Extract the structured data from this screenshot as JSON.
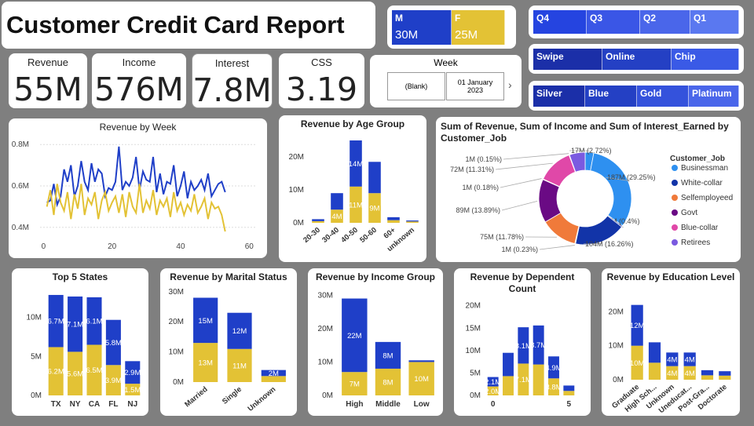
{
  "title": "Customer Credit Card Report",
  "colors": {
    "blue": "#1f3fc8",
    "gold": "#e3c235",
    "navy": "#1b2fa8"
  },
  "kpis": [
    {
      "label": "Revenue",
      "value": "55M"
    },
    {
      "label": "Income",
      "value": "576M"
    },
    {
      "label": "Interest",
      "value": "7.8M"
    },
    {
      "label": "CSS",
      "value": "3.19"
    }
  ],
  "gender": [
    {
      "label": "M",
      "value": "30M"
    },
    {
      "label": "F",
      "value": "25M"
    }
  ],
  "quarters": [
    "Q4",
    "Q3",
    "Q2",
    "Q1"
  ],
  "card_use": [
    "Swipe",
    "Online",
    "Chip"
  ],
  "card_category": [
    "Silver",
    "Blue",
    "Gold",
    "Platinum"
  ],
  "week": {
    "label": "Week",
    "options": [
      "(Blank)",
      "01 January 2023"
    ]
  },
  "chart_data": [
    {
      "id": "week",
      "type": "line",
      "title": "Revenue by Week",
      "ylim": [
        0.35,
        0.85
      ],
      "xlim": [
        -1,
        62
      ],
      "yticks": [
        "0.4M",
        "0.6M",
        "0.8M"
      ],
      "ytickvals": [
        0.4,
        0.6,
        0.8
      ],
      "xticks": [
        "0",
        "20",
        "40",
        "60"
      ],
      "xtickvals": [
        0,
        20,
        40,
        60
      ],
      "series": [
        {
          "values": [
            0.52,
            0.53,
            0.61,
            0.51,
            0.55,
            0.68,
            0.62,
            0.7,
            0.55,
            0.6,
            0.72,
            0.62,
            0.58,
            0.71,
            0.62,
            0.68,
            0.66,
            0.55,
            0.59,
            0.58,
            0.62,
            0.79,
            0.58,
            0.62,
            0.6,
            0.64,
            0.74,
            0.58,
            0.67,
            0.63,
            0.62,
            0.74,
            0.57,
            0.66,
            0.56,
            0.62,
            0.61,
            0.7,
            0.55,
            0.6,
            0.67,
            0.54,
            0.62,
            0.58,
            0.6,
            0.63,
            0.58,
            0.66,
            0.55,
            0.58,
            0.61,
            0.62,
            0.57
          ]
        },
        {
          "values": [
            0.5,
            0.58,
            0.46,
            0.61,
            0.52,
            0.48,
            0.57,
            0.44,
            0.56,
            0.49,
            0.61,
            0.46,
            0.54,
            0.51,
            0.57,
            0.44,
            0.53,
            0.57,
            0.48,
            0.52,
            0.55,
            0.47,
            0.56,
            0.45,
            0.57,
            0.5,
            0.47,
            0.61,
            0.47,
            0.53,
            0.49,
            0.58,
            0.46,
            0.53,
            0.5,
            0.54,
            0.45,
            0.57,
            0.48,
            0.52,
            0.46,
            0.51,
            0.48,
            0.56,
            0.47,
            0.5,
            0.54,
            0.44,
            0.52,
            0.49,
            0.5,
            0.46,
            0.38
          ]
        }
      ]
    },
    {
      "id": "age",
      "type": "bar",
      "title": "Revenue by Age Group",
      "categories": [
        "20-30",
        "30-40",
        "40-50",
        "50-60",
        "60+",
        "unknown"
      ],
      "ylim": [
        0,
        25
      ],
      "yticks": [
        "0M",
        "10M",
        "20M"
      ],
      "ytickvals": [
        0,
        10,
        20
      ],
      "series": [
        {
          "name": "F",
          "values": [
            0.5,
            4,
            11,
            9,
            0.8,
            0.4
          ],
          "labels": [
            "",
            "4M",
            "11M",
            "9M",
            "",
            ""
          ]
        },
        {
          "name": "M",
          "values": [
            0.6,
            5,
            14,
            9.5,
            0.9,
            0.3
          ],
          "labels": [
            "",
            "",
            "14M",
            "",
            "",
            ""
          ]
        }
      ]
    },
    {
      "id": "job",
      "type": "pie",
      "title": "Sum of Revenue, Sum of Income and Sum of Interest_Earned by Customer_Job",
      "legend_title": "Customer_Job",
      "legend": [
        {
          "name": "Businessman",
          "color": "#2e90f0"
        },
        {
          "name": "White-collar",
          "color": "#1234a8"
        },
        {
          "name": "Selfemployeed",
          "color": "#f07a3a"
        },
        {
          "name": "Govt",
          "color": "#6a0a84"
        },
        {
          "name": "Blue-collar",
          "color": "#e048a8"
        },
        {
          "name": "Retirees",
          "color": "#7a5ae0"
        }
      ],
      "slices": [
        {
          "label": "17M (2.72%)",
          "value": 2.72,
          "color": "#2e90f0"
        },
        {
          "label": "187M (29.25%)",
          "value": 29.25,
          "color": "#2e90f0"
        },
        {
          "label": "3M (0.4%)",
          "value": 0.4,
          "color": "#1234a8"
        },
        {
          "label": "104M (16.26%)",
          "value": 16.26,
          "color": "#1234a8"
        },
        {
          "label": "1M (0.23%)",
          "value": 0.23,
          "color": "#f07a3a"
        },
        {
          "label": "75M (11.78%)",
          "value": 11.78,
          "color": "#f07a3a"
        },
        {
          "label": "89M (13.89%)",
          "value": 13.89,
          "color": "#6a0a84"
        },
        {
          "label": "1M (0.18%)",
          "value": 0.18,
          "color": "#e048a8"
        },
        {
          "label": "72M (11.31%)",
          "value": 11.31,
          "color": "#e048a8"
        },
        {
          "label": "1M (0.15%)",
          "value": 0.15,
          "color": "#7a5ae0"
        },
        {
          "label": "",
          "value": 5.0,
          "color": "#7a5ae0"
        }
      ]
    },
    {
      "id": "states",
      "type": "bar",
      "title": "Top 5 States",
      "categories": [
        "TX",
        "NY",
        "CA",
        "FL",
        "NJ"
      ],
      "ylim": [
        0,
        13.5
      ],
      "yticks": [
        "0M",
        "5M",
        "10M"
      ],
      "ytickvals": [
        0,
        5,
        10
      ],
      "series": [
        {
          "name": "F",
          "values": [
            6.2,
            5.6,
            6.5,
            3.9,
            1.5
          ],
          "labels": [
            "6.2M",
            "5.6M",
            "6.5M",
            "3.9M",
            "1.5M"
          ]
        },
        {
          "name": "M",
          "values": [
            6.7,
            7.1,
            6.1,
            5.8,
            2.9
          ],
          "labels": [
            "6.7M",
            "7.1M",
            "6.1M",
            "5.8M",
            "2.9M"
          ]
        }
      ]
    },
    {
      "id": "marital",
      "type": "bar",
      "title": "Revenue by Marital Status",
      "categories": [
        "Married",
        "Single",
        "Unknown"
      ],
      "ylim": [
        0,
        31
      ],
      "yticks": [
        "0M",
        "10M",
        "20M",
        "30M"
      ],
      "ytickvals": [
        0,
        10,
        20,
        30
      ],
      "series": [
        {
          "name": "F",
          "values": [
            13,
            11,
            2
          ],
          "labels": [
            "13M",
            "11M",
            ""
          ]
        },
        {
          "name": "M",
          "values": [
            15,
            12,
            2
          ],
          "labels": [
            "15M",
            "12M",
            "2M"
          ]
        }
      ]
    },
    {
      "id": "income",
      "type": "bar",
      "title": "Revenue by Income Group",
      "categories": [
        "High",
        "Middle",
        "Low"
      ],
      "ylim": [
        0,
        31
      ],
      "yticks": [
        "0M",
        "10M",
        "20M",
        "30M"
      ],
      "ytickvals": [
        0,
        10,
        20,
        30
      ],
      "series": [
        {
          "name": "F",
          "values": [
            7,
            8,
            10
          ],
          "labels": [
            "7M",
            "8M",
            "10M"
          ]
        },
        {
          "name": "M",
          "values": [
            22,
            8,
            0.5
          ],
          "labels": [
            "22M",
            "8M",
            ""
          ]
        }
      ]
    },
    {
      "id": "dependent",
      "type": "bar",
      "title": "Revenue by Dependent Count",
      "categories": [
        "0",
        "1",
        "2",
        "3",
        "4",
        "5"
      ],
      "xticklabels": [
        "0",
        "",
        "",
        "",
        "",
        "5"
      ],
      "ylim": [
        0,
        21
      ],
      "yticks": [
        "0M",
        "5M",
        "10M",
        "15M",
        "20M"
      ],
      "ytickvals": [
        0,
        5,
        10,
        15,
        20
      ],
      "series": [
        {
          "name": "F",
          "values": [
            2.0,
            4.3,
            7.1,
            6.9,
            3.8,
            1.0
          ],
          "labels": [
            "2.0M",
            "",
            "7.1M",
            "",
            "3.8M",
            ""
          ]
        },
        {
          "name": "M",
          "values": [
            2.1,
            5.2,
            8.1,
            8.7,
            4.9,
            1.2
          ],
          "labels": [
            "2.1M",
            "",
            "8.1M",
            "8.7M",
            "4.9M",
            ""
          ]
        }
      ]
    },
    {
      "id": "education",
      "type": "bar",
      "title": "Revenue by Education Level",
      "categories": [
        "Graduate",
        "High Sch...",
        "Unknown",
        "Uneducat...",
        "Post-Gra...",
        "Doctorate"
      ],
      "ylim": [
        0,
        24
      ],
      "yticks": [
        "0M",
        "10M",
        "20M"
      ],
      "ytickvals": [
        0,
        10,
        20
      ],
      "series": [
        {
          "name": "F",
          "values": [
            10,
            5,
            4,
            4,
            1.3,
            1.2
          ],
          "labels": [
            "10M",
            "",
            "4M",
            "4M",
            "",
            ""
          ]
        },
        {
          "name": "M",
          "values": [
            12,
            6,
            4,
            4,
            1.5,
            1.3
          ],
          "labels": [
            "12M",
            "",
            "4M",
            "4M",
            "",
            ""
          ]
        }
      ]
    }
  ]
}
